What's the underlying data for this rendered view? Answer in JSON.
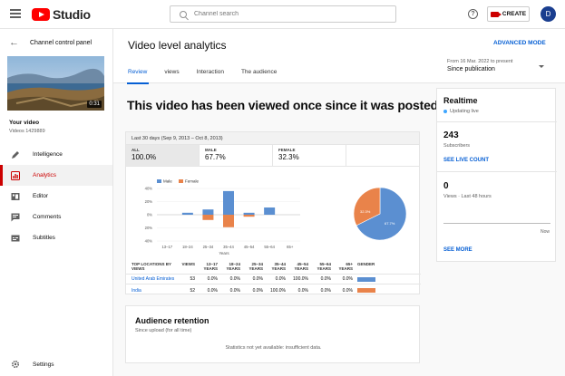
{
  "topbar": {
    "logo_text": "Studio",
    "search_placeholder": "Channel search",
    "help_label": "?",
    "create_label": "CREATE",
    "avatar_initial": "D"
  },
  "sidebar": {
    "back_label": "Channel control panel",
    "thumbnail_duration": "0:31",
    "video_title": "Your video",
    "video_id": "Videos 1429889",
    "items": [
      {
        "label": "Intelligence",
        "icon": "pencil-icon",
        "active": false
      },
      {
        "label": "Analytics",
        "icon": "analytics-icon",
        "active": true
      },
      {
        "label": "Editor",
        "icon": "editor-icon",
        "active": false
      },
      {
        "label": "Comments",
        "icon": "comments-icon",
        "active": false
      },
      {
        "label": "Subtitles",
        "icon": "subtitles-icon",
        "active": false
      }
    ],
    "settings_label": "Settings"
  },
  "header": {
    "title": "Video level analytics",
    "advanced_mode": "ADVANCED MODE",
    "tabs": [
      {
        "label": "Review",
        "active": true
      },
      {
        "label": "views",
        "active": false
      },
      {
        "label": "Interaction",
        "active": false
      },
      {
        "label": "The audience",
        "active": false
      }
    ],
    "date_from": "From 16 Mar. 2022 to present",
    "date_selected": "Since publication"
  },
  "headline": "This video has been viewed once since it was posted.",
  "demographics": {
    "period": "Last 30 days (Sep 9, 2013 – Oct 8, 2013)",
    "segments": [
      {
        "label": "ALL",
        "value": "100.0%"
      },
      {
        "label": "MALE",
        "value": "67.7%"
      },
      {
        "label": "FEMALE",
        "value": "32.3%"
      }
    ],
    "legend_male": "Male",
    "legend_female": "Female",
    "xlabel": "Years",
    "pie_female_label": "32.3%",
    "pie_male_label": "67.7%",
    "table": {
      "headers": [
        "TOP LOCATIONS BY VIEWS",
        "VIEWS",
        "13–17 YEARS",
        "18–24 YEARS",
        "25–34 YEARS",
        "35–44 YEARS",
        "45–54 YEARS",
        "55–64 YEARS",
        "65+ YEARS",
        "GENDER"
      ],
      "rows": [
        {
          "location": "United Arab Emirates",
          "views": "53",
          "cells": [
            "0.0%",
            "0.0%",
            "0.0%",
            "0.0%",
            "100.0%",
            "0.0%",
            "0.0%"
          ],
          "gender_bar": "male"
        },
        {
          "location": "India",
          "views": "52",
          "cells": [
            "0.0%",
            "0.0%",
            "0.0%",
            "100.0%",
            "0.0%",
            "0.0%",
            "0.0%"
          ],
          "gender_bar": "female"
        }
      ]
    }
  },
  "chart_data": [
    {
      "type": "bar",
      "categories": [
        "13–17",
        "18–24",
        "25–34",
        "35–44",
        "45–54",
        "55–64",
        "65+"
      ],
      "xlabel": "Years",
      "ylabel": "",
      "ylim": [
        -40,
        40
      ],
      "yticks": [
        "40%",
        "20%",
        "0%",
        "20%",
        "40%"
      ],
      "series": [
        {
          "name": "Male",
          "values": [
            0,
            3,
            8,
            36,
            3,
            11,
            0
          ]
        },
        {
          "name": "Female",
          "values": [
            0,
            0,
            -8,
            -19,
            -3,
            0,
            0
          ]
        }
      ],
      "colors": {
        "Male": "#5b8fd1",
        "Female": "#e9834a"
      }
    },
    {
      "type": "pie",
      "labels": [
        "Male",
        "Female"
      ],
      "values": [
        67.7,
        32.3
      ],
      "colors": [
        "#5b8fd1",
        "#e9834a"
      ]
    }
  ],
  "retention": {
    "title": "Audience retention",
    "subtitle": "Since upload (for all time)",
    "message": "Statistics not yet available: insufficient data."
  },
  "realtime": {
    "title": "Realtime",
    "live_label": "Updating live",
    "subscribers_value": "243",
    "subscribers_label": "Subscribers",
    "see_live_count": "SEE LIVE COUNT",
    "views_value": "0",
    "views_label": "Views · Last 48 hours",
    "now_label": "Now",
    "see_more": "SEE MORE"
  },
  "colors": {
    "accent": "#065fd4",
    "brand_red": "#ff0000",
    "active_nav": "#cc0000",
    "male": "#5b8fd1",
    "female": "#e9834a"
  }
}
